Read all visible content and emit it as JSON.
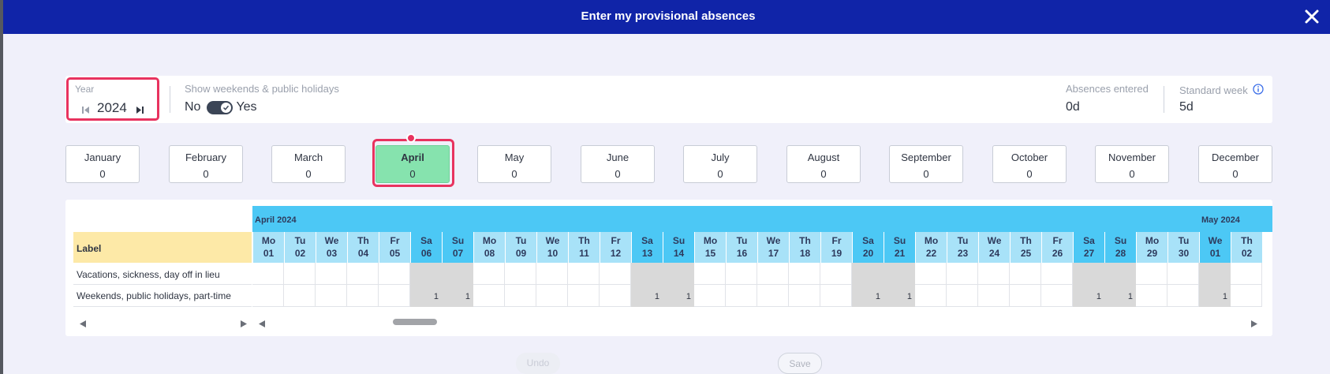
{
  "window": {
    "title": "Enter my provisional absences"
  },
  "year": {
    "label": "Year",
    "value": "2024"
  },
  "weekends_toggle": {
    "label": "Show weekends & public holidays",
    "off_label": "No",
    "on_label": "Yes",
    "state": "on"
  },
  "absences": {
    "label": "Absences entered",
    "value": "0d"
  },
  "standard_week": {
    "label": "Standard week",
    "value": "5d"
  },
  "months": [
    {
      "name": "January",
      "count": "0"
    },
    {
      "name": "February",
      "count": "0"
    },
    {
      "name": "March",
      "count": "0"
    },
    {
      "name": "April",
      "count": "0",
      "active": true
    },
    {
      "name": "May",
      "count": "0"
    },
    {
      "name": "June",
      "count": "0"
    },
    {
      "name": "July",
      "count": "0"
    },
    {
      "name": "August",
      "count": "0"
    },
    {
      "name": "September",
      "count": "0"
    },
    {
      "name": "October",
      "count": "0"
    },
    {
      "name": "November",
      "count": "0"
    },
    {
      "name": "December",
      "count": "0"
    }
  ],
  "grid": {
    "label_header": "Label",
    "month_bands": [
      "April 2024",
      "May 2024"
    ],
    "days": [
      {
        "dow": "Mo",
        "num": "01",
        "we": false
      },
      {
        "dow": "Tu",
        "num": "02",
        "we": false
      },
      {
        "dow": "We",
        "num": "03",
        "we": false
      },
      {
        "dow": "Th",
        "num": "04",
        "we": false
      },
      {
        "dow": "Fr",
        "num": "05",
        "we": false
      },
      {
        "dow": "Sa",
        "num": "06",
        "we": true
      },
      {
        "dow": "Su",
        "num": "07",
        "we": true
      },
      {
        "dow": "Mo",
        "num": "08",
        "we": false
      },
      {
        "dow": "Tu",
        "num": "09",
        "we": false
      },
      {
        "dow": "We",
        "num": "10",
        "we": false
      },
      {
        "dow": "Th",
        "num": "11",
        "we": false
      },
      {
        "dow": "Fr",
        "num": "12",
        "we": false
      },
      {
        "dow": "Sa",
        "num": "13",
        "we": true
      },
      {
        "dow": "Su",
        "num": "14",
        "we": true
      },
      {
        "dow": "Mo",
        "num": "15",
        "we": false
      },
      {
        "dow": "Tu",
        "num": "16",
        "we": false
      },
      {
        "dow": "We",
        "num": "17",
        "we": false
      },
      {
        "dow": "Th",
        "num": "18",
        "we": false
      },
      {
        "dow": "Fr",
        "num": "19",
        "we": false
      },
      {
        "dow": "Sa",
        "num": "20",
        "we": true
      },
      {
        "dow": "Su",
        "num": "21",
        "we": true
      },
      {
        "dow": "Mo",
        "num": "22",
        "we": false
      },
      {
        "dow": "Tu",
        "num": "23",
        "we": false
      },
      {
        "dow": "We",
        "num": "24",
        "we": false
      },
      {
        "dow": "Th",
        "num": "25",
        "we": false
      },
      {
        "dow": "Fr",
        "num": "26",
        "we": false
      },
      {
        "dow": "Sa",
        "num": "27",
        "we": true
      },
      {
        "dow": "Su",
        "num": "28",
        "we": true
      },
      {
        "dow": "Mo",
        "num": "29",
        "we": false
      },
      {
        "dow": "Tu",
        "num": "30",
        "we": false
      },
      {
        "dow": "We",
        "num": "01",
        "we": true,
        "month": 1
      },
      {
        "dow": "Th",
        "num": "02",
        "we": false,
        "month": 1
      }
    ],
    "rows": [
      {
        "label": "Vacations, sickness, day off in lieu",
        "marker": ""
      },
      {
        "label": "Weekends, public holidays, part-time",
        "marker": "1"
      }
    ]
  },
  "buttons": {
    "undo": "Undo",
    "save": "Save"
  },
  "icons": [
    "close-icon",
    "prev-year-icon",
    "next-year-icon",
    "check-icon",
    "info-icon",
    "scroll-left-icon",
    "scroll-right-icon"
  ],
  "colors": {
    "header": "#1024a8",
    "highlight": "#e8335f",
    "active_month": "#86e3ae",
    "month_band": "#4cc8f5",
    "day_header": "#a8e2f8",
    "label_header": "#fde9a7",
    "weekend_cell": "#d9d9d9"
  }
}
